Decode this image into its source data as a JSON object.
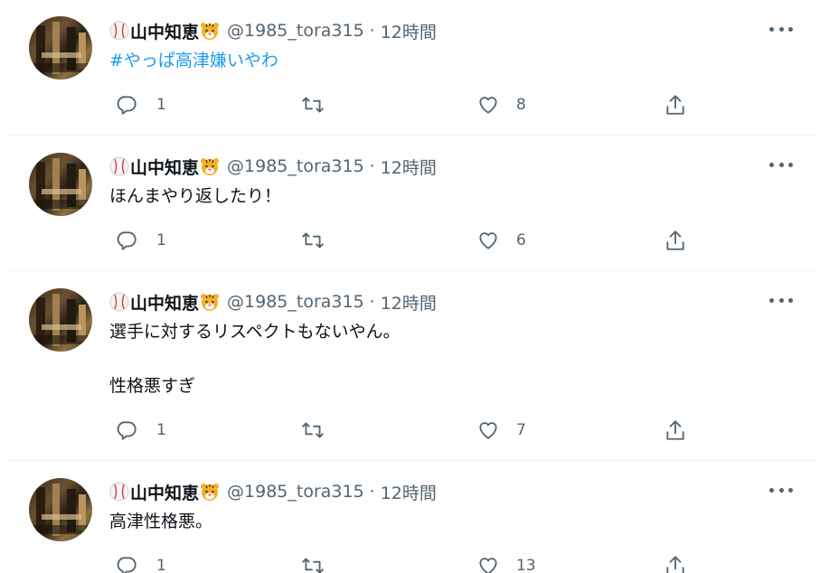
{
  "tweets": [
    {
      "display_name": "山中知恵",
      "handle": "@1985_tora315",
      "separator": "·",
      "time": "12時間",
      "text": "#やっぱ高津嫌いやわ",
      "replies": "1",
      "retweets": "",
      "likes": "8"
    },
    {
      "display_name": "山中知恵",
      "handle": "@1985_tora315",
      "separator": "·",
      "time": "12時間",
      "text": "ほんまやり返したり！",
      "replies": "1",
      "retweets": "",
      "likes": "6"
    },
    {
      "display_name": "山中知恵",
      "handle": "@1985_tora315",
      "separator": "·",
      "time": "12時間",
      "text": "選手に対するリスペクトもないやん。\n\n性格悪すぎ",
      "replies": "1",
      "retweets": "",
      "likes": "7"
    },
    {
      "display_name": "山中知恵",
      "handle": "@1985_tora315",
      "separator": "·",
      "time": "12時間",
      "text": "高津性格悪。",
      "replies": "1",
      "retweets": "",
      "likes": "13"
    }
  ],
  "icons": {
    "name_prefix": "baseball-icon",
    "name_suffix": "tiger-face-icon",
    "reply": "reply-icon",
    "retweet": "retweet-icon",
    "like": "heart-icon",
    "share": "share-icon",
    "more": "more-icon"
  },
  "colors": {
    "hashtag": "#1d9bf0",
    "secondary_text": "#536471",
    "primary_text": "#0f1419",
    "divider": "#eff3f4"
  }
}
